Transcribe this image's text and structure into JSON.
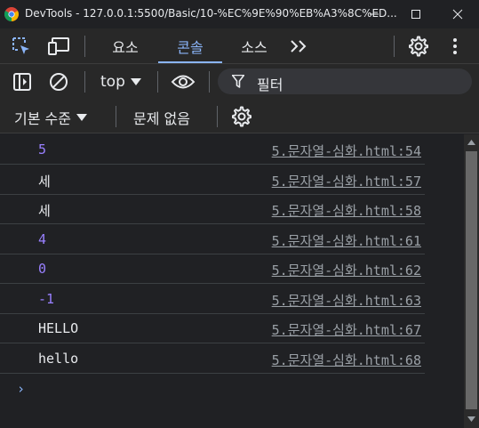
{
  "window": {
    "title": "DevTools - 127.0.0.1:5500/Basic/10-%EC%9E%90%EB%A3%8C%ED..."
  },
  "tabs": {
    "elements": "요소",
    "console": "콘솔",
    "sources": "소스"
  },
  "toolbar": {
    "context": "top",
    "filter_placeholder": "필터"
  },
  "levels": {
    "default_levels": "기본 수준",
    "issues": "문제 없음"
  },
  "console_rows": [
    {
      "value": "5",
      "type": "number",
      "source": "5.문자열-심화.html:54"
    },
    {
      "value": "세",
      "type": "string",
      "source": "5.문자열-심화.html:57"
    },
    {
      "value": "세",
      "type": "string",
      "source": "5.문자열-심화.html:58"
    },
    {
      "value": "4",
      "type": "number",
      "source": "5.문자열-심화.html:61"
    },
    {
      "value": "0",
      "type": "number",
      "source": "5.문자열-심화.html:62"
    },
    {
      "value": "-1",
      "type": "number",
      "source": "5.문자열-심화.html:63"
    },
    {
      "value": "HELLO",
      "type": "string",
      "source": "5.문자열-심화.html:67"
    },
    {
      "value": "hello",
      "type": "string",
      "source": "5.문자열-심화.html:68"
    }
  ],
  "prompt": "›",
  "colors": {
    "accent": "#8ab4f8",
    "number": "#9980ff",
    "background": "#202124",
    "toolbar": "#282828"
  }
}
